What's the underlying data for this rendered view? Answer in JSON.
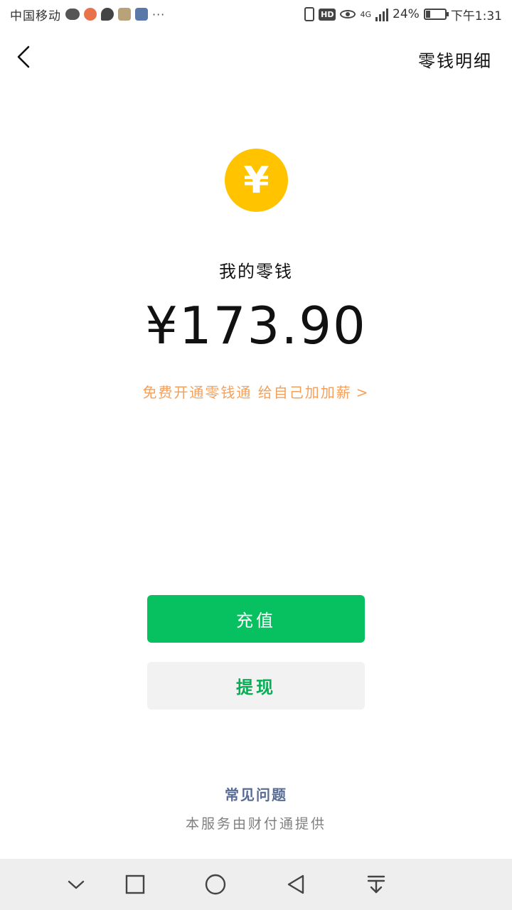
{
  "status_bar": {
    "carrier": "中国移动",
    "more": "···",
    "network": "4G",
    "battery_percent": "24%",
    "battery_level": 0.24,
    "time": "下午1:31",
    "icons": [
      "wechat-icon",
      "weibo-icon",
      "chat-bubble-icon",
      "app-icon",
      "app-icon",
      "vibrate-icon",
      "hd-icon",
      "eye-icon",
      "signal-icon",
      "battery-icon"
    ]
  },
  "header": {
    "back_icon": "chevron-left-icon",
    "detail_label": "零钱明细"
  },
  "balance": {
    "coin_symbol": "¥",
    "label": "我的零钱",
    "amount": "¥173.90",
    "promo_text": "免费开通零钱通 给自己加加薪",
    "promo_chevron": ">"
  },
  "actions": {
    "recharge_label": "充值",
    "withdraw_label": "提现"
  },
  "footer": {
    "faq_label": "常见问题",
    "provider_text": "本服务由财付通提供"
  },
  "nav_bar": {
    "icons": [
      "chevron-down-icon",
      "recent-apps-icon",
      "home-icon",
      "back-icon",
      "notification-pull-icon"
    ]
  },
  "colors": {
    "coin": "#FFC300",
    "promo": "#F5A05A",
    "recharge_bg": "#07C160",
    "withdraw_text": "#06AE56",
    "faq": "#576B95",
    "provider": "#7F7F7F"
  }
}
